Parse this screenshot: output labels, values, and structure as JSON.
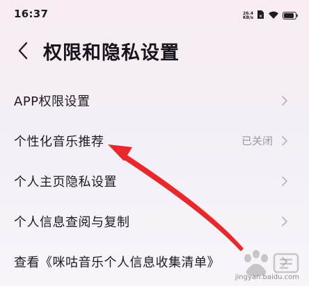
{
  "status_bar": {
    "time": "16:37",
    "net_speed_value": "26.4",
    "net_speed_unit": "KB/s"
  },
  "header": {
    "title": "权限和隐私设置"
  },
  "settings": {
    "items": [
      {
        "label": "APP权限设置",
        "value": ""
      },
      {
        "label": "个性化音乐推荐",
        "value": "已关闭"
      },
      {
        "label": "个人主页隐私设置",
        "value": ""
      },
      {
        "label": "个人信息查阅与复制",
        "value": ""
      },
      {
        "label": "查看《咪咕音乐个人信息收集清单》",
        "value": ""
      }
    ]
  },
  "watermark": {
    "url": "jingyan.baidu.com"
  },
  "colors": {
    "annotation_arrow": "#e8282b",
    "text_primary": "#1d1a20",
    "text_secondary": "#9a97a0",
    "chevron": "#b4b1b8"
  },
  "icons": {
    "back": "back-chevron-icon",
    "row_chevron": "chevron-right-icon",
    "sim": "sim-card-icon",
    "wifi": "wifi-icon",
    "battery": "battery-icon"
  }
}
